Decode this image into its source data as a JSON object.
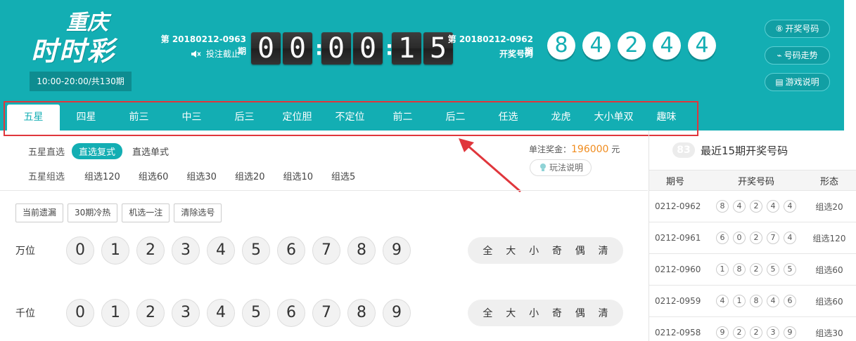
{
  "logo": {
    "line1": "重庆",
    "line2": "时时彩",
    "hours": "10:00-20:00/共130期"
  },
  "current": {
    "issue": "第 20180212-0963 期",
    "status": "投注截止",
    "countdown": [
      "0",
      "0",
      ":",
      "0",
      "0",
      ":",
      "1",
      "5"
    ]
  },
  "last": {
    "issue": "第 20180212-0962 期",
    "label": "开奖号码",
    "numbers": [
      "8",
      "4",
      "2",
      "4",
      "4"
    ]
  },
  "side_buttons": [
    {
      "icon": "⑧",
      "label": "开奖号码"
    },
    {
      "icon": "⌁",
      "label": "号码走势"
    },
    {
      "icon": "▤",
      "label": "游戏说明"
    }
  ],
  "tabs": [
    "五星",
    "四星",
    "前三",
    "中三",
    "后三",
    "定位胆",
    "不定位",
    "前二",
    "后二",
    "任选",
    "龙虎",
    "大小单双",
    "趣味"
  ],
  "subplay": {
    "row1_title": "五星直选",
    "row1_items": [
      "直选复式",
      "直选单式"
    ],
    "row2_title": "五星组选",
    "row2_items": [
      "组选120",
      "组选60",
      "组选30",
      "组选20",
      "组选10",
      "组选5"
    ]
  },
  "prize": {
    "label": "单注奖金：",
    "amount": "196000",
    "unit": " 元",
    "help": "玩法说明"
  },
  "tools": [
    "当前遗漏",
    "30期冷热",
    "机选一注",
    "清除选号"
  ],
  "positions": [
    {
      "label": "万位",
      "digits": [
        "0",
        "1",
        "2",
        "3",
        "4",
        "5",
        "6",
        "7",
        "8",
        "9"
      ]
    },
    {
      "label": "千位",
      "digits": [
        "0",
        "1",
        "2",
        "3",
        "4",
        "5",
        "6",
        "7",
        "8",
        "9"
      ]
    }
  ],
  "filters": [
    "全",
    "大",
    "小",
    "奇",
    "偶",
    "清"
  ],
  "history": {
    "badge": "83",
    "title": "最近15期开奖号码",
    "columns": [
      "期号",
      "开奖号码",
      "形态"
    ],
    "rows": [
      {
        "issue": "0212-0962",
        "balls": [
          "8",
          "4",
          "2",
          "4",
          "4"
        ],
        "form": "组选20"
      },
      {
        "issue": "0212-0961",
        "balls": [
          "6",
          "0",
          "2",
          "7",
          "4"
        ],
        "form": "组选120"
      },
      {
        "issue": "0212-0960",
        "balls": [
          "1",
          "8",
          "2",
          "5",
          "5"
        ],
        "form": "组选60"
      },
      {
        "issue": "0212-0959",
        "balls": [
          "4",
          "1",
          "8",
          "4",
          "6"
        ],
        "form": "组选60"
      },
      {
        "issue": "0212-0958",
        "balls": [
          "9",
          "2",
          "2",
          "3",
          "9"
        ],
        "form": "组选30"
      }
    ]
  },
  "colors": {
    "brand": "#13aeb3",
    "highlight": "#e0363c",
    "prize": "#f08c1e"
  }
}
